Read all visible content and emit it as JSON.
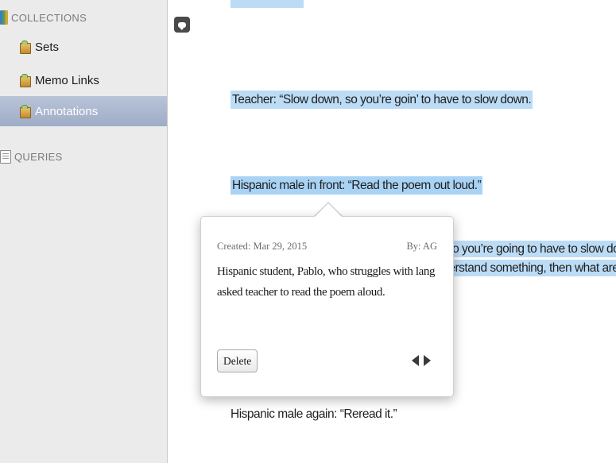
{
  "sidebar": {
    "collections_header": "COLLECTIONS",
    "items": [
      {
        "label": "Sets"
      },
      {
        "label": "Memo Links"
      },
      {
        "label": "Annotations"
      }
    ],
    "queries_header": "QUERIES"
  },
  "document": {
    "lines": [
      "Teacher: “Slow down, so you’re goin’ to have to slow down.",
      "Hispanic male in front: “Read the poem out loud.”",
      "Hispanic male again: “Reread it.”"
    ],
    "behind_popover": [
      "ay, so you’re going to have to slow down,",
      "understand something, then what are you"
    ]
  },
  "popover": {
    "created": "Created: Mar 29, 2015",
    "author": "By: AG",
    "note": "Hispanic student, Pablo, who struggles with lang asked teacher to read the poem aloud.",
    "delete_label": "Delete"
  },
  "colors": {
    "highlight": "#bcdcf6",
    "selected_item": "#a7b4cc"
  }
}
